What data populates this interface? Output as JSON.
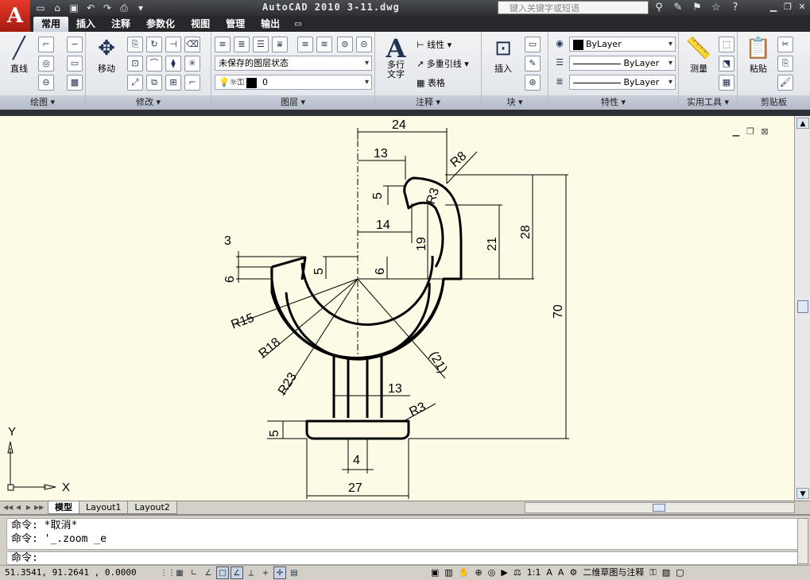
{
  "app": {
    "logo": "A",
    "title": "AutoCAD 2010   3-11.dwg",
    "search_placeholder": "键入关键字或短语"
  },
  "tabs": [
    {
      "label": "常用"
    },
    {
      "label": "插入"
    },
    {
      "label": "注释"
    },
    {
      "label": "参数化"
    },
    {
      "label": "视图"
    },
    {
      "label": "管理"
    },
    {
      "label": "输出"
    }
  ],
  "ribbon": {
    "draw": {
      "title": "绘图 ▾",
      "line": "直线"
    },
    "modify": {
      "title": "修改 ▾",
      "move": "移动"
    },
    "layers": {
      "title": "图层 ▾",
      "state": "未保存的图层状态",
      "current": "0"
    },
    "annotation": {
      "title": "注释 ▾",
      "mtext": "多行\n文字",
      "linear": "线性",
      "mleader": "多重引线",
      "table": "表格"
    },
    "block": {
      "title": "块 ▾",
      "insert": "插入"
    },
    "properties": {
      "title": "特性 ▾",
      "color": "ByLayer",
      "linetype": "ByLayer",
      "lineweight": "ByLayer"
    },
    "utilities": {
      "title": "实用工具 ▾",
      "measure": "测量"
    },
    "clipboard": {
      "title": "剪贴板",
      "paste": "粘贴"
    }
  },
  "drawing": {
    "dims": {
      "d24": "24",
      "d13a": "13",
      "d5a": "5",
      "d14": "14",
      "d19": "19",
      "d21": "21",
      "d28": "28",
      "d70": "70",
      "d3": "3",
      "d6a": "6",
      "d5b": "5",
      "d6b": "6",
      "r8": "R8",
      "r3a": "R3",
      "r15": "R15",
      "r18": "R18",
      "r23": "R23",
      "r21": "(21)",
      "d13b": "13",
      "r3b": "R3",
      "d5c": "5",
      "d4": "4",
      "d27": "27"
    },
    "ucs": {
      "x": "X",
      "y": "Y"
    }
  },
  "layout_tabs": [
    {
      "label": "模型"
    },
    {
      "label": "Layout1"
    },
    {
      "label": "Layout2"
    }
  ],
  "command": {
    "history": [
      "命令: *取消*",
      "命令: '_.zoom _e"
    ],
    "prompt": "命令:"
  },
  "status": {
    "coords": "51.3541,  91.2641 , 0.0000",
    "scale": "1:1",
    "workspace": "二维草图与注释"
  },
  "colors": {
    "canvas": "#fdfbe6",
    "titlebar": "#2d2f33",
    "ribbon": "#e6e9ee"
  }
}
